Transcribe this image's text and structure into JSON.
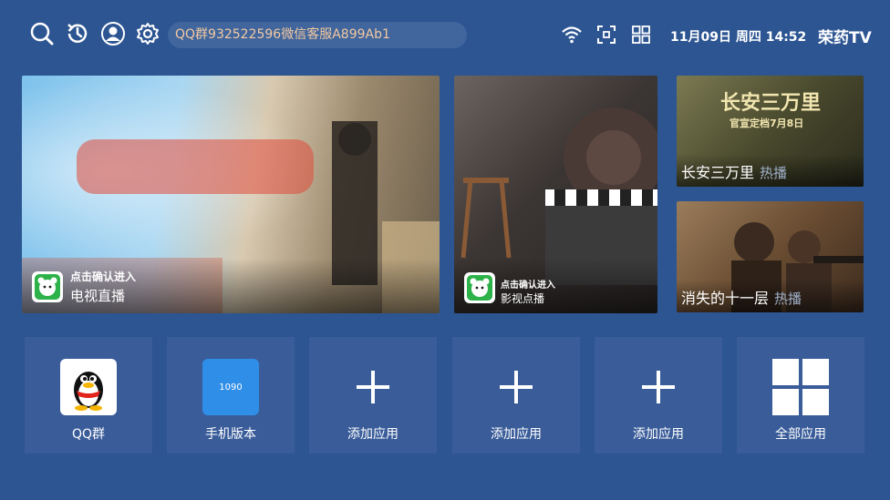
{
  "topbar": {
    "icons": [
      "search-icon",
      "history-icon",
      "user-icon",
      "gear-icon"
    ],
    "marquee": "QQ群932522596微信客服A899Ab1",
    "status_icons": [
      "wifi-icon",
      "fullscreen-icon",
      "grid-icon"
    ],
    "datetime": "11月09日 周四 14:52",
    "brand": "荣药TV"
  },
  "tiles": {
    "live": {
      "line1": "点击确认进入",
      "line2": "电视直播"
    },
    "vod": {
      "line1": "点击确认进入",
      "line2": "影视点播"
    },
    "show_a": {
      "title": "长安三万里",
      "tag": "热播",
      "poster_text": "长安三万里",
      "poster_sub": "官宣定档7月8日"
    },
    "show_b": {
      "title": "消失的十一层",
      "tag": "热播"
    }
  },
  "apps": [
    {
      "label": "QQ群",
      "icon": "qq-penguin-icon"
    },
    {
      "label": "手机版本",
      "icon": "phone-version-icon",
      "icon_text": "1090"
    },
    {
      "label": "添加应用",
      "icon": "plus-icon"
    },
    {
      "label": "添加应用",
      "icon": "plus-icon"
    },
    {
      "label": "添加应用",
      "icon": "plus-icon"
    },
    {
      "label": "全部应用",
      "icon": "all-apps-icon"
    }
  ],
  "colors": {
    "background": "#2c5592",
    "tile": "#3a5d9a",
    "marquee_text": "#f3c9a0",
    "badge_green": "#2db24a"
  }
}
